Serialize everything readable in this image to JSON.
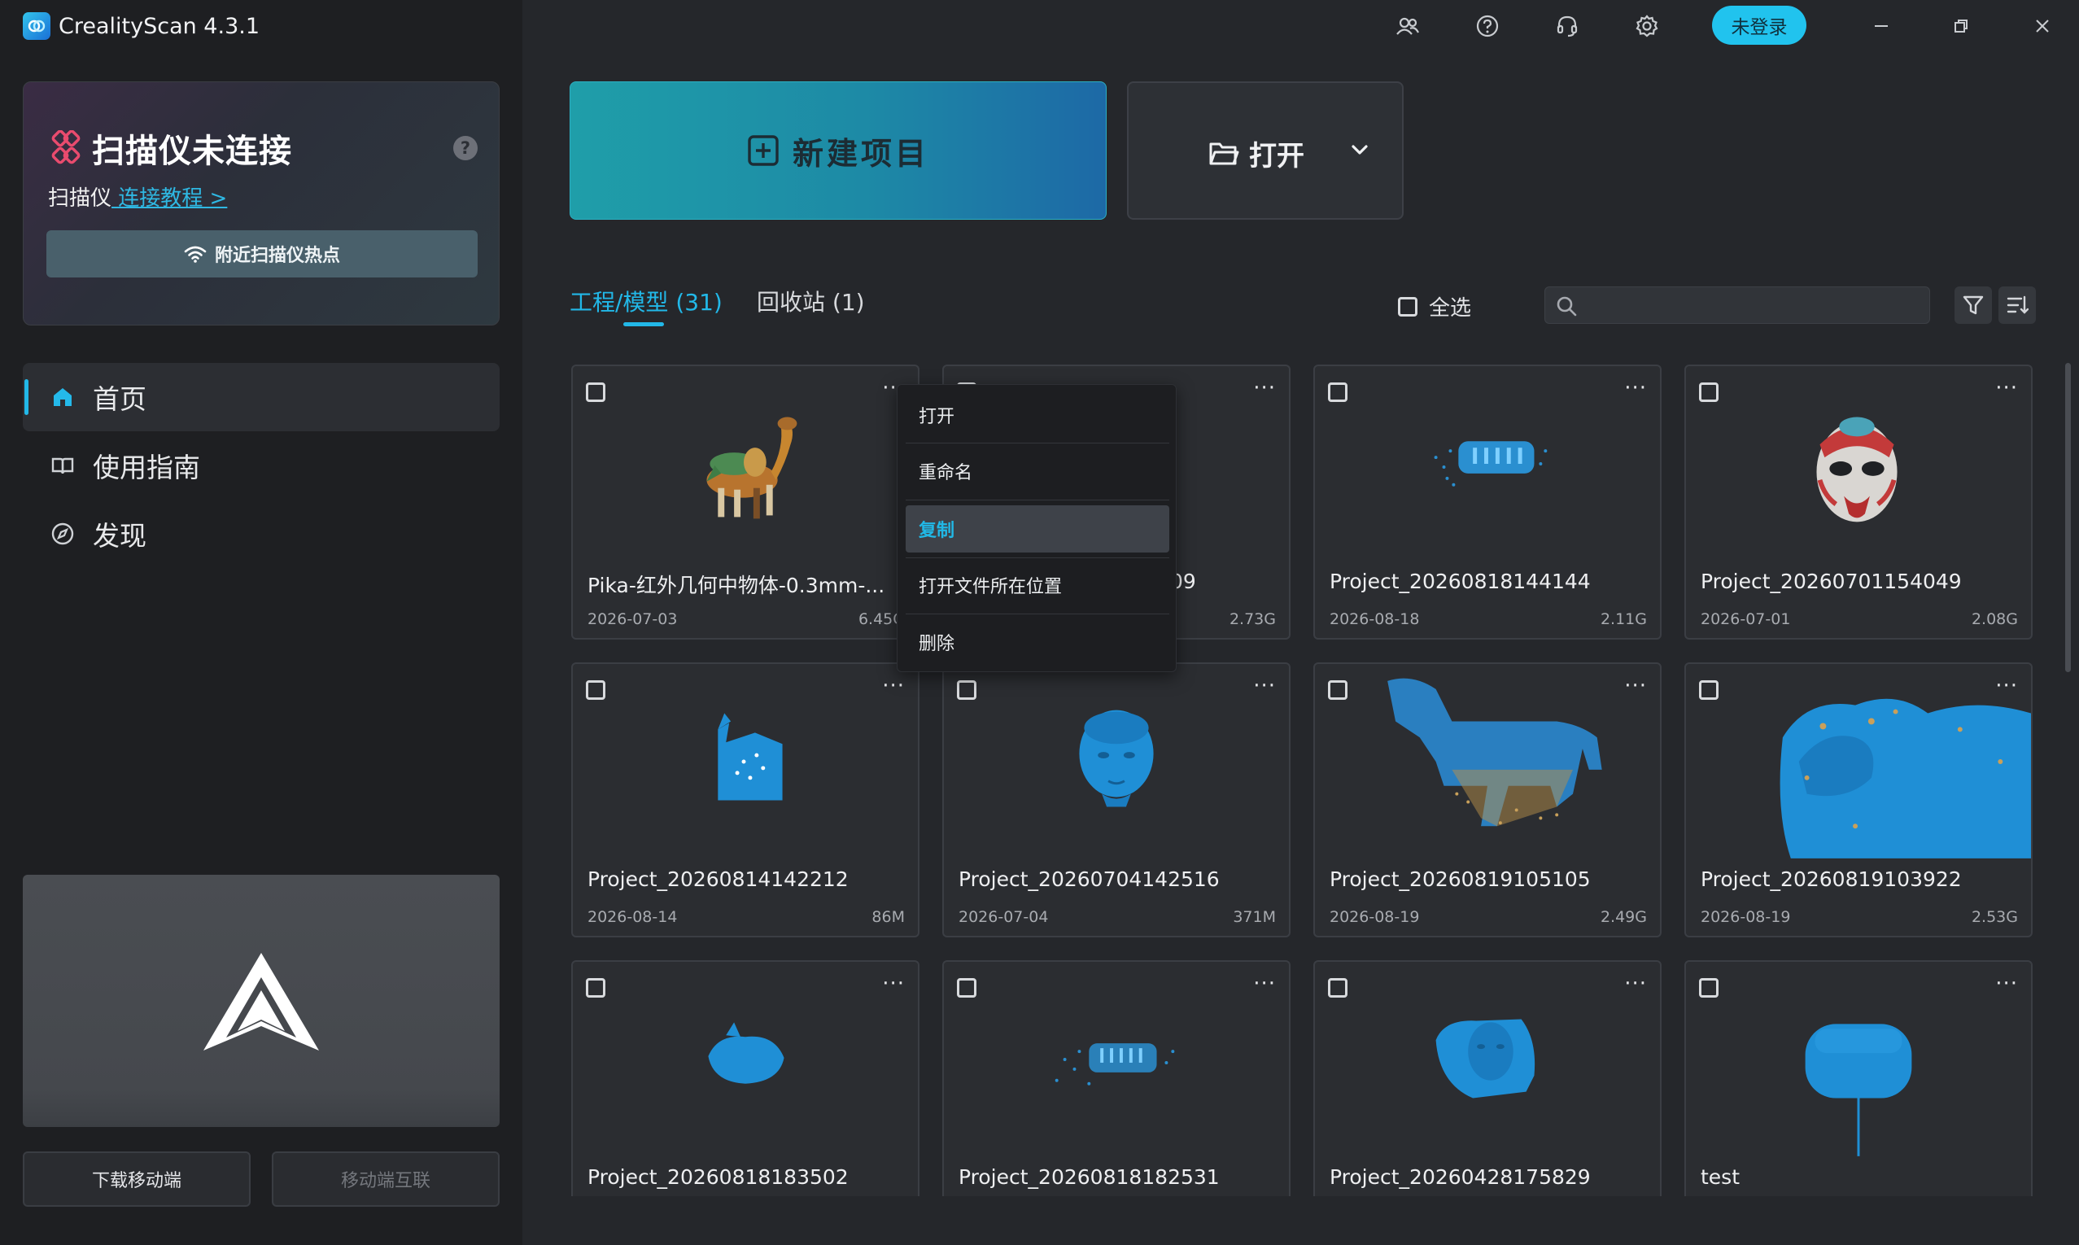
{
  "app": {
    "title": "CrealityScan 4.3.1"
  },
  "scanner": {
    "title": "扫描仪未连接",
    "help": "?",
    "sub_prefix": "扫描仪",
    "tutorial_link": " 连接教程 >",
    "hotspot_button": "附近扫描仪热点"
  },
  "nav": {
    "home": "首页",
    "guide": "使用指南",
    "discover": "发现"
  },
  "bottom": {
    "download": "下载移动端",
    "mobile_link": "移动端互联"
  },
  "topbar": {
    "login": "未登录",
    "icons": [
      "community-icon",
      "help-icon",
      "support-headset-icon",
      "settings-gear-icon"
    ],
    "window_controls": [
      "minimize-icon",
      "restore-icon",
      "close-icon"
    ]
  },
  "actions": {
    "new_project": "新建项目",
    "open": "打开"
  },
  "tabs": {
    "models": "工程/模型 (31)",
    "recycle": "回收站 (1)"
  },
  "toolbar": {
    "select_all": "全选",
    "search_placeholder": ""
  },
  "projects": [
    {
      "name": "Pika-红外几何中物体-0.3mm-...",
      "date": "2026-07-03",
      "size": "6.45G"
    },
    {
      "name": "09",
      "date": "",
      "size": "2.73G"
    },
    {
      "name": "Project_20260818144144",
      "date": "2026-08-18",
      "size": "2.11G"
    },
    {
      "name": "Project_20260701154049",
      "date": "2026-07-01",
      "size": "2.08G"
    },
    {
      "name": "Project_20260814142212",
      "date": "2026-08-14",
      "size": "86M"
    },
    {
      "name": "Project_20260704142516",
      "date": "2026-07-04",
      "size": "371M"
    },
    {
      "name": "Project_20260819105105",
      "date": "2026-08-19",
      "size": "2.49G"
    },
    {
      "name": "Project_20260819103922",
      "date": "2026-08-19",
      "size": "2.53G"
    },
    {
      "name": "Project_20260818183502",
      "date": "",
      "size": ""
    },
    {
      "name": "Project_20260818182531",
      "date": "",
      "size": ""
    },
    {
      "name": "Project_20260428175829",
      "date": "",
      "size": ""
    },
    {
      "name": "test",
      "date": "",
      "size": ""
    }
  ],
  "context_menu": {
    "items": [
      "打开",
      "重命名",
      "复制",
      "打开文件所在位置",
      "删除"
    ],
    "highlighted": "复制"
  },
  "colors": {
    "accent": "#22b8e8",
    "model_blue": "#1f8fd6",
    "sidebar_bg": "#1e1f22",
    "main_bg": "#25272b"
  }
}
